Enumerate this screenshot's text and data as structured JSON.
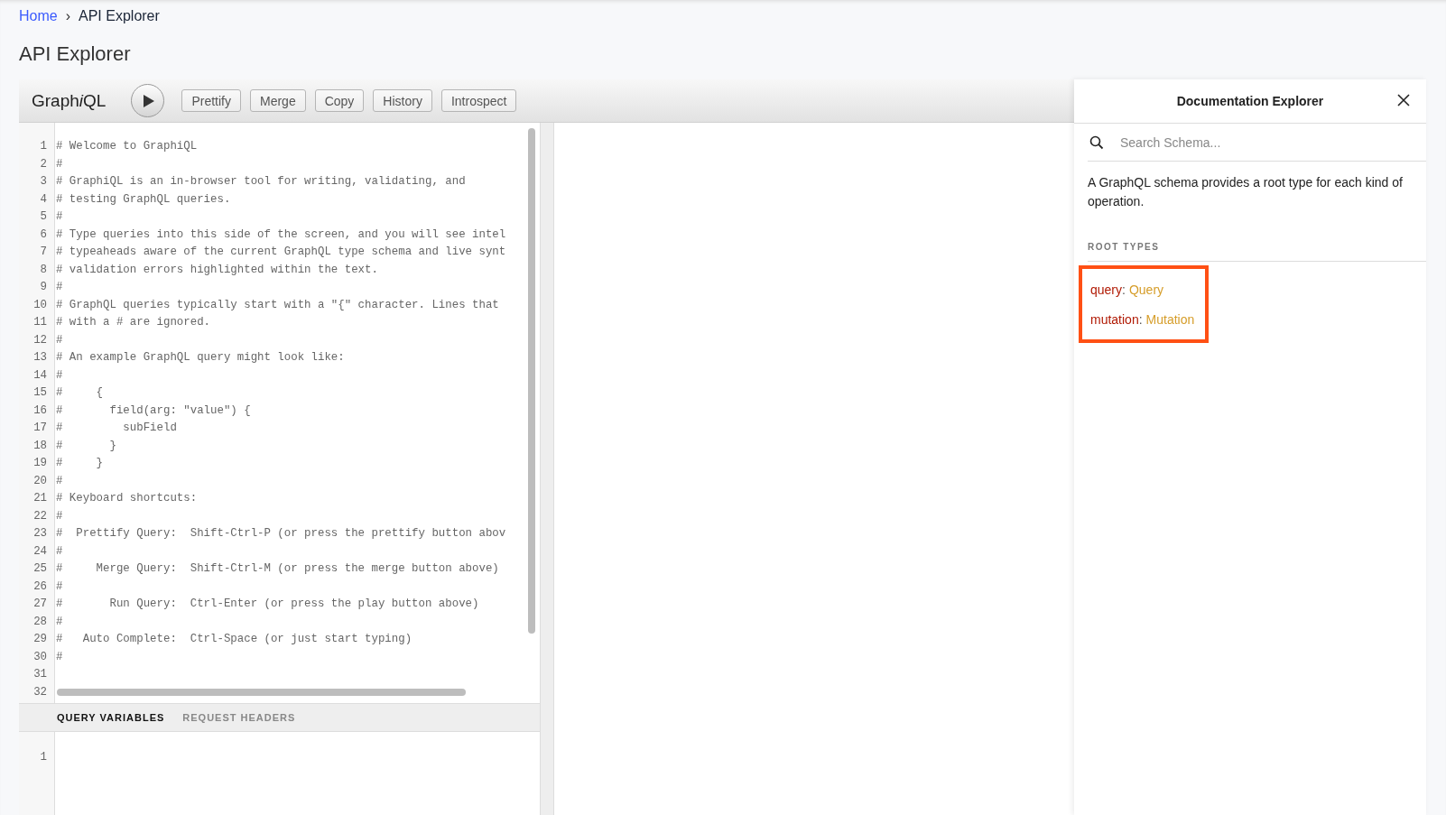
{
  "breadcrumb": [
    {
      "label": "Home",
      "kind": "link"
    },
    {
      "label": "API Explorer",
      "kind": "current"
    }
  ],
  "breadcrumb_separator": "›",
  "page_title": "API Explorer",
  "toolbar": {
    "logo": [
      {
        "text": "Graph",
        "kind": "plain"
      },
      {
        "text": "i",
        "kind": "italic"
      },
      {
        "text": "QL",
        "kind": "plain"
      }
    ],
    "buttons": [
      "Prettify",
      "Merge",
      "Copy",
      "History",
      "Introspect"
    ]
  },
  "editor": {
    "lines": [
      {
        "number": "1",
        "text": "# Welcome to GraphiQL"
      },
      {
        "number": "2",
        "text": "#"
      },
      {
        "number": "3",
        "text": "# GraphiQL is an in-browser tool for writing, validating, and"
      },
      {
        "number": "4",
        "text": "# testing GraphQL queries."
      },
      {
        "number": "5",
        "text": "#"
      },
      {
        "number": "6",
        "text": "# Type queries into this side of the screen, and you will see intel"
      },
      {
        "number": "7",
        "text": "# typeaheads aware of the current GraphQL type schema and live synt"
      },
      {
        "number": "8",
        "text": "# validation errors highlighted within the text."
      },
      {
        "number": "9",
        "text": "#"
      },
      {
        "number": "10",
        "text": "# GraphQL queries typically start with a \"{\" character. Lines that"
      },
      {
        "number": "11",
        "text": "# with a # are ignored."
      },
      {
        "number": "12",
        "text": "#"
      },
      {
        "number": "13",
        "text": "# An example GraphQL query might look like:"
      },
      {
        "number": "14",
        "text": "#"
      },
      {
        "number": "15",
        "text": "#     {"
      },
      {
        "number": "16",
        "text": "#       field(arg: \"value\") {"
      },
      {
        "number": "17",
        "text": "#         subField"
      },
      {
        "number": "18",
        "text": "#       }"
      },
      {
        "number": "19",
        "text": "#     }"
      },
      {
        "number": "20",
        "text": "#"
      },
      {
        "number": "21",
        "text": "# Keyboard shortcuts:"
      },
      {
        "number": "22",
        "text": "#"
      },
      {
        "number": "23",
        "text": "#  Prettify Query:  Shift-Ctrl-P (or press the prettify button abov"
      },
      {
        "number": "24",
        "text": "#"
      },
      {
        "number": "25",
        "text": "#     Merge Query:  Shift-Ctrl-M (or press the merge button above)"
      },
      {
        "number": "26",
        "text": "#"
      },
      {
        "number": "27",
        "text": "#       Run Query:  Ctrl-Enter (or press the play button above)"
      },
      {
        "number": "28",
        "text": "#"
      },
      {
        "number": "29",
        "text": "#   Auto Complete:  Ctrl-Space (or just start typing)"
      },
      {
        "number": "30",
        "text": "#"
      },
      {
        "number": "31"
      },
      {
        "number": "32"
      }
    ]
  },
  "variables": {
    "tabs": [
      {
        "label": "QUERY VARIABLES",
        "selected": true
      },
      {
        "label": "REQUEST HEADERS",
        "selected": false
      }
    ],
    "lines": [
      {
        "number": "1"
      }
    ]
  },
  "docs": {
    "title": "Documentation Explorer",
    "search_placeholder": "Search Schema...",
    "description": "A GraphQL schema provides a root type for each kind of operation.",
    "section_label": "ROOT TYPES",
    "highlighted": true,
    "root_types": [
      {
        "name": "query",
        "separator": ":",
        "type": "Query"
      },
      {
        "name": "mutation",
        "separator": ":",
        "type": "Mutation"
      }
    ]
  }
}
